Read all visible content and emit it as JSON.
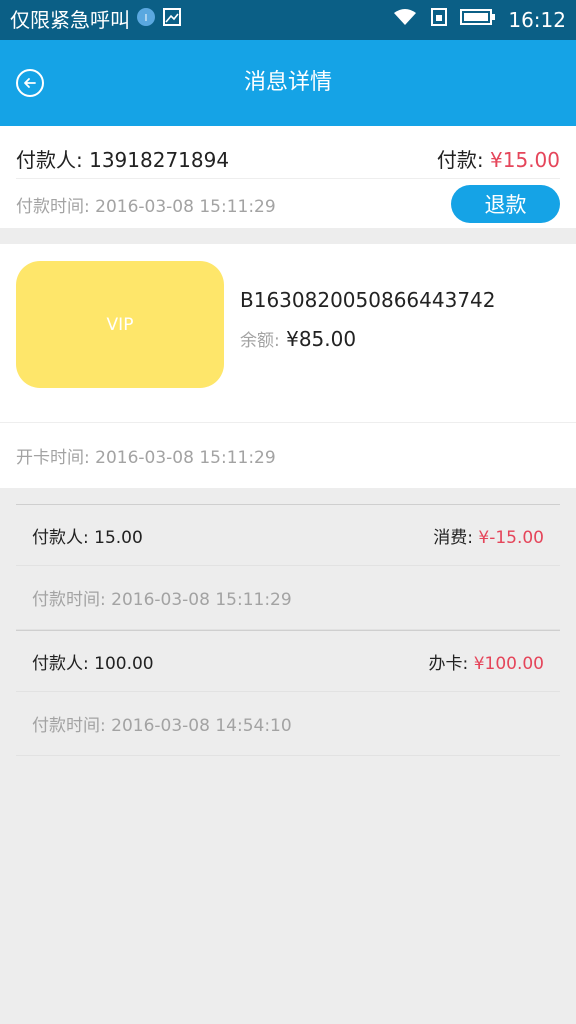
{
  "status_bar": {
    "carrier": "仅限紧急呼叫",
    "time": "16:12"
  },
  "header": {
    "title": "消息详情",
    "back_icon": "back-arrow-icon"
  },
  "payment": {
    "payer_label": "付款人:",
    "payer_value": "13918271894",
    "amount_label": "付款:",
    "amount_value": "¥15.00",
    "time_label": "付款时间:",
    "time_value": "2016-03-08 15:11:29",
    "refund_label": "退款"
  },
  "card": {
    "card_label": "VIP",
    "card_number": "B1630820050866443742",
    "balance_label": "余额:",
    "balance_value": "¥85.00",
    "open_time_label": "开卡时间:",
    "open_time_value": "2016-03-08 15:11:29",
    "card_color": "#fee66a"
  },
  "records": [
    {
      "payer_label": "付款人:",
      "payer_value": "15.00",
      "type_label": "消费:",
      "type_value": "¥-15.00",
      "time_label": "付款时间:",
      "time_value": "2016-03-08 15:11:29"
    },
    {
      "payer_label": "付款人:",
      "payer_value": "100.00",
      "type_label": "办卡:",
      "type_value": "¥100.00",
      "time_label": "付款时间:",
      "time_value": "2016-03-08 14:54:10"
    }
  ],
  "colors": {
    "accent": "#15a3e6",
    "status_bar": "#0b5f86",
    "money": "#e5455a"
  }
}
